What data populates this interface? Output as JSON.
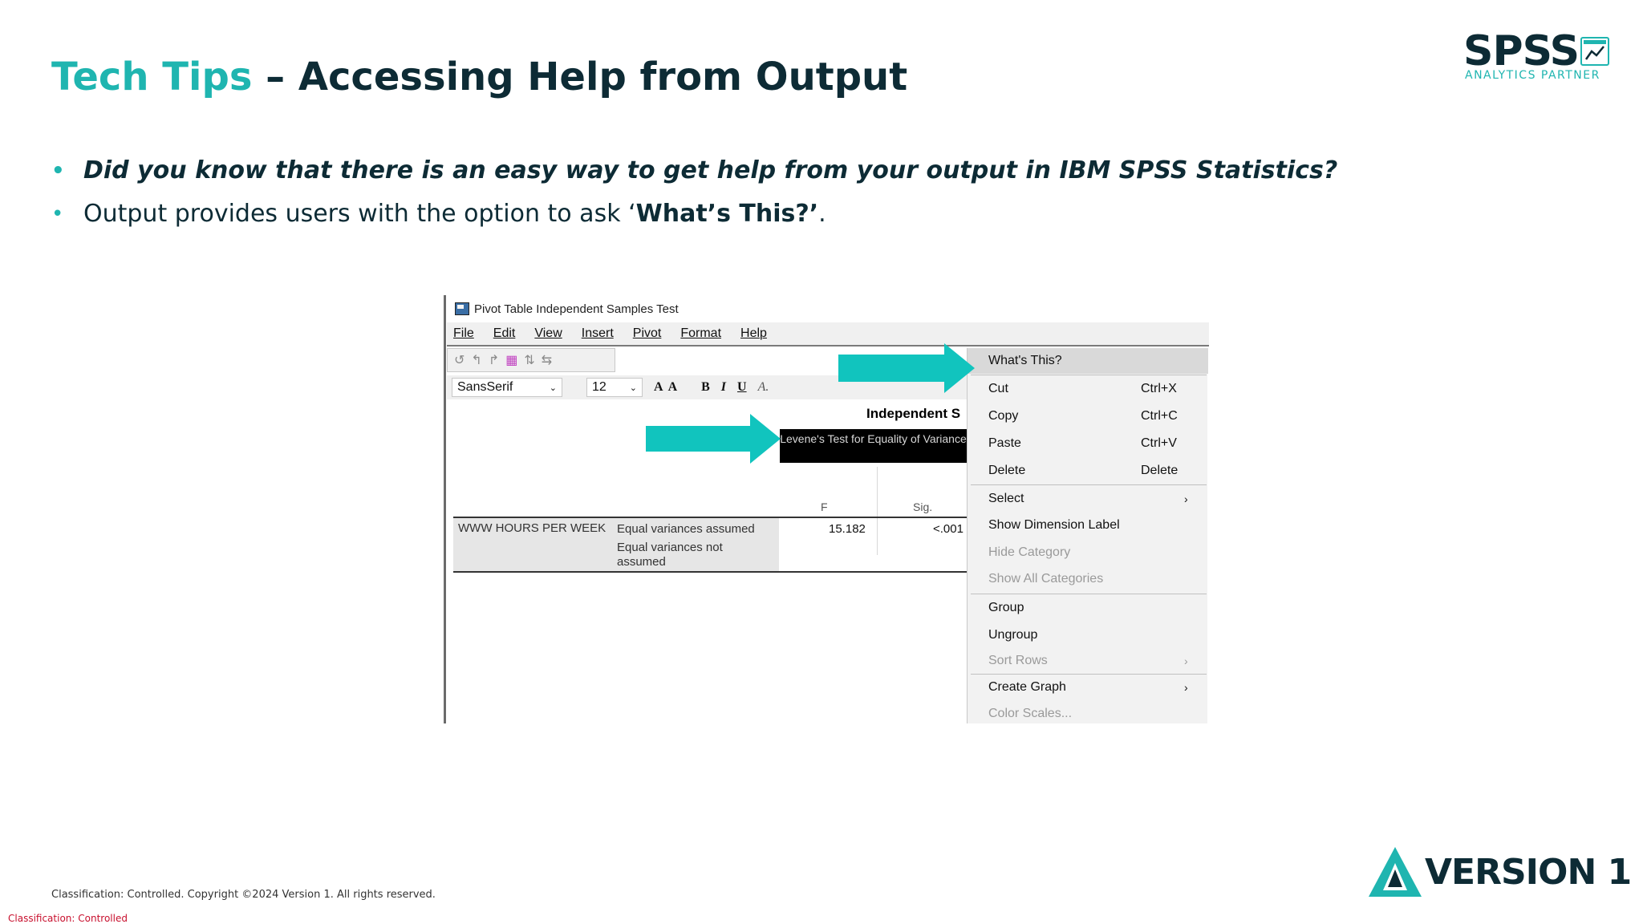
{
  "slide": {
    "title_accent": "Tech Tips",
    "title_rest": " – Accessing Help from Output",
    "bullets": {
      "q": "Did you know that there is an easy way to get help from your output in IBM SPSS Statistics?",
      "b2_pre": "Output provides users with the option to ask ‘",
      "b2_bold": "What’s This?’",
      "b2_post": "."
    },
    "footer": "Classification: Controlled. Copyright ©2024 Version 1. All rights reserved.",
    "classification": "Classification: Controlled"
  },
  "logos": {
    "spss": "SPSS",
    "spss_sub": "ANALYTICS PARTNER",
    "version1": "VERSION 1"
  },
  "window": {
    "title": "Pivot Table Independent Samples Test",
    "menu": [
      "File",
      "Edit",
      "View",
      "Insert",
      "Pivot",
      "Format",
      "Help"
    ],
    "font_combo": "SansSerif",
    "size_combo": "12",
    "format_buttons": [
      "A",
      "A",
      "B",
      "I",
      "U",
      "A."
    ]
  },
  "table": {
    "title": "Independent S",
    "levene_header": "Levene's Test for Equality of Variances",
    "col_f": "F",
    "col_sig": "Sig.",
    "row_var": "WWW HOURS PER WEEK",
    "row1_label": "Equal variances assumed",
    "row2_label": "Equal variances not assumed",
    "f_value": "15.182",
    "sig_value": "<.001"
  },
  "context_menu": {
    "items": [
      {
        "label": "What's This?",
        "shortcut": "",
        "submenu": false,
        "disabled": false,
        "highlight": true
      },
      {
        "label": "Cut",
        "shortcut": "Ctrl+X",
        "submenu": false,
        "disabled": false
      },
      {
        "label": "Copy",
        "shortcut": "Ctrl+C",
        "submenu": false,
        "disabled": false
      },
      {
        "label": "Paste",
        "shortcut": "Ctrl+V",
        "submenu": false,
        "disabled": false
      },
      {
        "label": "Delete",
        "shortcut": "Delete",
        "submenu": false,
        "disabled": false
      },
      {
        "label": "Select",
        "shortcut": "",
        "submenu": true,
        "disabled": false
      },
      {
        "label": "Show Dimension Label",
        "shortcut": "",
        "submenu": false,
        "disabled": false
      },
      {
        "label": "Hide Category",
        "shortcut": "",
        "submenu": false,
        "disabled": true
      },
      {
        "label": "Show All Categories",
        "shortcut": "",
        "submenu": false,
        "disabled": true
      },
      {
        "label": "Group",
        "shortcut": "",
        "submenu": false,
        "disabled": false
      },
      {
        "label": "Ungroup",
        "shortcut": "",
        "submenu": false,
        "disabled": false
      },
      {
        "label": "Sort Rows",
        "shortcut": "",
        "submenu": true,
        "disabled": true
      },
      {
        "label": "Create Graph",
        "shortcut": "",
        "submenu": true,
        "disabled": false
      },
      {
        "label": "Color Scales...",
        "shortcut": "",
        "submenu": false,
        "disabled": true
      }
    ]
  },
  "colors": {
    "accent": "#1fb5b0",
    "dark": "#0d2b35",
    "arrow": "#11c4be",
    "classification": "#c8102e"
  }
}
